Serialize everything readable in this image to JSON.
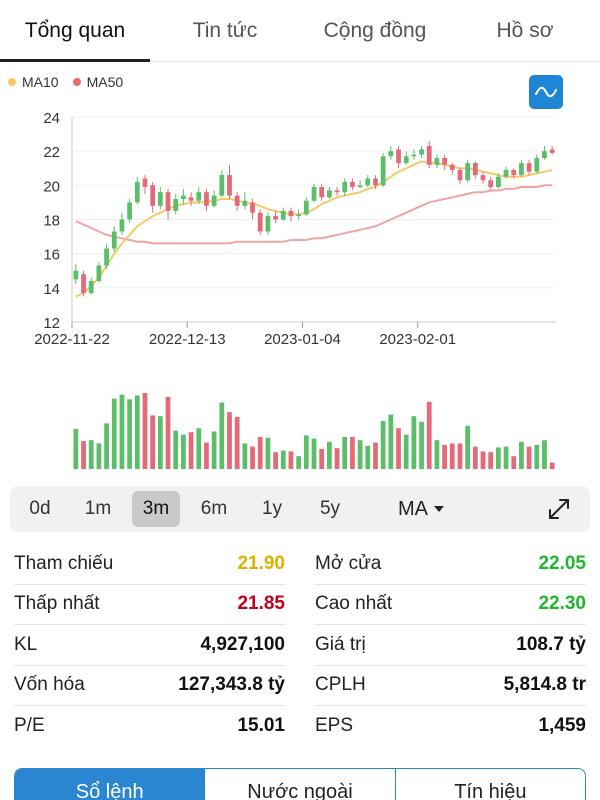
{
  "tabs": [
    {
      "label": "Tổng quan",
      "active": true
    },
    {
      "label": "Tin tức",
      "active": false
    },
    {
      "label": "Cộng đồng",
      "active": false
    },
    {
      "label": "Hồ sơ",
      "active": false
    }
  ],
  "legend": [
    {
      "label": "MA10",
      "color": "#f5c86b"
    },
    {
      "label": "MA50",
      "color": "#e96c6c"
    }
  ],
  "chart_button_icon": "line-chart-icon",
  "colors": {
    "up": "#5bbf6a",
    "down": "#e56a78",
    "ma10": "#f5c86b",
    "ma50": "#f2a4a4"
  },
  "chart_data": {
    "type": "candlestick",
    "ylim": [
      12,
      24
    ],
    "yticks": [
      "12",
      "14",
      "16",
      "18",
      "20",
      "22",
      "24"
    ],
    "xticks": [
      {
        "label": "2022-11-22",
        "index": 0
      },
      {
        "label": "2022-12-13",
        "index": 15
      },
      {
        "label": "2023-01-04",
        "index": 30
      },
      {
        "label": "2023-02-01",
        "index": 45
      }
    ],
    "candles": [
      {
        "o": 14.5,
        "c": 15.0,
        "h": 15.4,
        "l": 14.2,
        "v": 5
      },
      {
        "o": 14.8,
        "c": 13.7,
        "h": 15.0,
        "l": 13.5,
        "v": 3.5
      },
      {
        "o": 13.7,
        "c": 14.4,
        "h": 14.6,
        "l": 13.6,
        "v": 3.6
      },
      {
        "o": 14.4,
        "c": 15.3,
        "h": 15.5,
        "l": 14.3,
        "v": 3.2
      },
      {
        "o": 15.3,
        "c": 16.3,
        "h": 16.6,
        "l": 15.1,
        "v": 5.7
      },
      {
        "o": 16.3,
        "c": 17.3,
        "h": 17.6,
        "l": 16.1,
        "v": 8.8
      },
      {
        "o": 17.3,
        "c": 18.0,
        "h": 18.4,
        "l": 17.1,
        "v": 9.3
      },
      {
        "o": 18.0,
        "c": 19.0,
        "h": 19.2,
        "l": 17.8,
        "v": 8.7
      },
      {
        "o": 19.0,
        "c": 20.2,
        "h": 20.5,
        "l": 18.9,
        "v": 9.2
      },
      {
        "o": 20.4,
        "c": 19.9,
        "h": 20.6,
        "l": 19.5,
        "v": 9.5
      },
      {
        "o": 20.0,
        "c": 18.8,
        "h": 20.2,
        "l": 18.4,
        "v": 6.7
      },
      {
        "o": 18.8,
        "c": 19.6,
        "h": 19.9,
        "l": 18.6,
        "v": 6.6
      },
      {
        "o": 19.6,
        "c": 18.5,
        "h": 19.8,
        "l": 18.0,
        "v": 9.0
      },
      {
        "o": 18.5,
        "c": 19.2,
        "h": 19.5,
        "l": 18.3,
        "v": 4.8
      },
      {
        "o": 19.2,
        "c": 19.4,
        "h": 19.8,
        "l": 18.9,
        "v": 4.3
      },
      {
        "o": 19.3,
        "c": 19.1,
        "h": 19.6,
        "l": 18.8,
        "v": 4.6
      },
      {
        "o": 19.1,
        "c": 19.6,
        "h": 19.9,
        "l": 18.9,
        "v": 5.1
      },
      {
        "o": 19.6,
        "c": 18.8,
        "h": 19.8,
        "l": 18.5,
        "v": 3.3
      },
      {
        "o": 18.8,
        "c": 19.4,
        "h": 19.7,
        "l": 18.7,
        "v": 4.7
      },
      {
        "o": 19.4,
        "c": 20.6,
        "h": 20.9,
        "l": 19.3,
        "v": 8.3
      },
      {
        "o": 20.6,
        "c": 19.4,
        "h": 21.2,
        "l": 19.2,
        "v": 7.1
      },
      {
        "o": 19.4,
        "c": 18.8,
        "h": 19.6,
        "l": 18.5,
        "v": 6.5
      },
      {
        "o": 18.8,
        "c": 19.1,
        "h": 19.6,
        "l": 18.6,
        "v": 3.2
      },
      {
        "o": 19.0,
        "c": 18.4,
        "h": 19.2,
        "l": 18.0,
        "v": 2.8
      },
      {
        "o": 18.4,
        "c": 17.3,
        "h": 18.6,
        "l": 17.1,
        "v": 4.0
      },
      {
        "o": 17.3,
        "c": 18.2,
        "h": 18.4,
        "l": 17.1,
        "v": 3.9
      },
      {
        "o": 18.2,
        "c": 18.0,
        "h": 18.5,
        "l": 17.8,
        "v": 2.1
      },
      {
        "o": 18.0,
        "c": 18.5,
        "h": 18.7,
        "l": 17.9,
        "v": 2.3
      },
      {
        "o": 18.5,
        "c": 18.2,
        "h": 18.7,
        "l": 17.9,
        "v": 2.2
      },
      {
        "o": 18.2,
        "c": 18.3,
        "h": 18.6,
        "l": 18.0,
        "v": 1.6
      },
      {
        "o": 18.3,
        "c": 19.1,
        "h": 19.3,
        "l": 18.2,
        "v": 4.2
      },
      {
        "o": 19.1,
        "c": 19.9,
        "h": 20.1,
        "l": 19.0,
        "v": 3.8
      },
      {
        "o": 19.9,
        "c": 19.3,
        "h": 20.1,
        "l": 19.1,
        "v": 2.5
      },
      {
        "o": 19.3,
        "c": 19.7,
        "h": 19.9,
        "l": 19.2,
        "v": 3.4
      },
      {
        "o": 19.7,
        "c": 19.6,
        "h": 19.9,
        "l": 19.4,
        "v": 2.6
      },
      {
        "o": 19.6,
        "c": 20.2,
        "h": 20.4,
        "l": 19.4,
        "v": 4.0
      },
      {
        "o": 20.2,
        "c": 19.9,
        "h": 20.4,
        "l": 19.7,
        "v": 4.0
      },
      {
        "o": 19.9,
        "c": 20.0,
        "h": 20.3,
        "l": 19.8,
        "v": 3.6
      },
      {
        "o": 20.0,
        "c": 20.4,
        "h": 20.6,
        "l": 19.9,
        "v": 2.9
      },
      {
        "o": 20.4,
        "c": 20.0,
        "h": 20.6,
        "l": 19.8,
        "v": 3.3
      },
      {
        "o": 20.0,
        "c": 21.7,
        "h": 21.9,
        "l": 19.9,
        "v": 6.0
      },
      {
        "o": 21.7,
        "c": 22.0,
        "h": 22.3,
        "l": 21.5,
        "v": 6.8
      },
      {
        "o": 22.1,
        "c": 21.3,
        "h": 22.3,
        "l": 21.0,
        "v": 5.1
      },
      {
        "o": 21.3,
        "c": 21.7,
        "h": 22.0,
        "l": 21.2,
        "v": 4.3
      },
      {
        "o": 21.7,
        "c": 21.8,
        "h": 22.1,
        "l": 21.5,
        "v": 6.6
      },
      {
        "o": 21.8,
        "c": 22.1,
        "h": 22.3,
        "l": 21.6,
        "v": 5.9
      },
      {
        "o": 22.3,
        "c": 21.2,
        "h": 22.6,
        "l": 21.0,
        "v": 8.4
      },
      {
        "o": 21.2,
        "c": 21.6,
        "h": 21.8,
        "l": 21.0,
        "v": 3.6
      },
      {
        "o": 21.6,
        "c": 21.2,
        "h": 21.8,
        "l": 20.9,
        "v": 3.0
      },
      {
        "o": 21.2,
        "c": 20.9,
        "h": 21.3,
        "l": 20.6,
        "v": 3.2
      },
      {
        "o": 20.9,
        "c": 20.3,
        "h": 21.0,
        "l": 20.1,
        "v": 3.2
      },
      {
        "o": 20.3,
        "c": 21.3,
        "h": 21.5,
        "l": 20.2,
        "v": 5.4
      },
      {
        "o": 21.3,
        "c": 20.6,
        "h": 21.4,
        "l": 20.4,
        "v": 2.8
      },
      {
        "o": 20.6,
        "c": 20.3,
        "h": 20.8,
        "l": 20.1,
        "v": 2.2
      },
      {
        "o": 20.3,
        "c": 19.9,
        "h": 20.5,
        "l": 19.7,
        "v": 2.1
      },
      {
        "o": 19.9,
        "c": 20.5,
        "h": 20.7,
        "l": 19.8,
        "v": 2.7
      },
      {
        "o": 20.5,
        "c": 20.9,
        "h": 21.1,
        "l": 20.4,
        "v": 2.8
      },
      {
        "o": 20.9,
        "c": 20.6,
        "h": 21.0,
        "l": 20.4,
        "v": 1.6
      },
      {
        "o": 20.6,
        "c": 21.3,
        "h": 21.5,
        "l": 20.5,
        "v": 3.4
      },
      {
        "o": 21.3,
        "c": 20.8,
        "h": 21.5,
        "l": 20.6,
        "v": 2.8
      },
      {
        "o": 20.8,
        "c": 21.6,
        "h": 21.8,
        "l": 20.7,
        "v": 3.0
      },
      {
        "o": 21.6,
        "c": 22.0,
        "h": 22.3,
        "l": 21.5,
        "v": 3.6
      },
      {
        "o": 22.1,
        "c": 21.9,
        "h": 22.3,
        "l": 21.8,
        "v": 0.8
      }
    ],
    "ma10": [
      13.5,
      13.7,
      14.1,
      14.6,
      15.3,
      16.0,
      16.6,
      17.1,
      17.6,
      17.9,
      18.2,
      18.4,
      18.6,
      18.8,
      18.9,
      19.0,
      19.0,
      19.0,
      19.1,
      19.2,
      19.2,
      19.1,
      19.0,
      18.9,
      18.8,
      18.6,
      18.5,
      18.4,
      18.3,
      18.3,
      18.4,
      18.6,
      18.9,
      19.1,
      19.3,
      19.4,
      19.5,
      19.6,
      19.8,
      19.9,
      20.2,
      20.5,
      20.8,
      21.0,
      21.2,
      21.4,
      21.3,
      21.3,
      21.2,
      21.1,
      21.0,
      21.0,
      20.9,
      20.8,
      20.7,
      20.6,
      20.5,
      20.5,
      20.5,
      20.6,
      20.7,
      20.8,
      20.9
    ],
    "ma50": [
      17.9,
      17.7,
      17.5,
      17.3,
      17.1,
      17.0,
      16.9,
      16.8,
      16.7,
      16.7,
      16.6,
      16.6,
      16.6,
      16.6,
      16.6,
      16.6,
      16.6,
      16.6,
      16.6,
      16.6,
      16.6,
      16.7,
      16.7,
      16.7,
      16.7,
      16.7,
      16.7,
      16.7,
      16.8,
      16.8,
      16.8,
      16.9,
      16.9,
      17.0,
      17.1,
      17.2,
      17.3,
      17.4,
      17.5,
      17.6,
      17.8,
      18.0,
      18.2,
      18.4,
      18.6,
      18.8,
      19.0,
      19.1,
      19.2,
      19.3,
      19.4,
      19.5,
      19.6,
      19.6,
      19.7,
      19.7,
      19.8,
      19.8,
      19.9,
      19.9,
      19.9,
      20.0,
      20.0
    ]
  },
  "range": {
    "buttons": [
      {
        "label": "0d",
        "active": false
      },
      {
        "label": "1m",
        "active": false
      },
      {
        "label": "3m",
        "active": true
      },
      {
        "label": "6m",
        "active": false
      },
      {
        "label": "1y",
        "active": false
      },
      {
        "label": "5y",
        "active": false
      }
    ],
    "ma_label": "MA",
    "expand_icon": "expand-icon"
  },
  "stats": [
    [
      {
        "label": "Tham chiếu",
        "value": "21.90",
        "color": "#e0b000"
      },
      {
        "label": "Mở cửa",
        "value": "22.05",
        "color": "#21b52f"
      }
    ],
    [
      {
        "label": "Thấp nhất",
        "value": "21.85",
        "color": "#c0001a"
      },
      {
        "label": "Cao nhất",
        "value": "22.30",
        "color": "#21b52f"
      }
    ],
    [
      {
        "label": "KL",
        "value": "4,927,100",
        "color": "#111111"
      },
      {
        "label": "Giá trị",
        "value": "108.7 tỷ",
        "color": "#111111"
      }
    ],
    [
      {
        "label": "Vốn hóa",
        "value": "127,343.8 tỷ",
        "color": "#111111"
      },
      {
        "label": "CPLH",
        "value": "5,814.8 tr",
        "color": "#111111"
      }
    ],
    [
      {
        "label": "P/E",
        "value": "15.01",
        "color": "#111111"
      },
      {
        "label": "EPS",
        "value": "1,459",
        "color": "#111111"
      }
    ]
  ],
  "bottom_tabs": [
    {
      "label": "Sổ lệnh",
      "active": true
    },
    {
      "label": "Nước ngoài",
      "active": false
    },
    {
      "label": "Tín hiệu",
      "active": false
    }
  ]
}
